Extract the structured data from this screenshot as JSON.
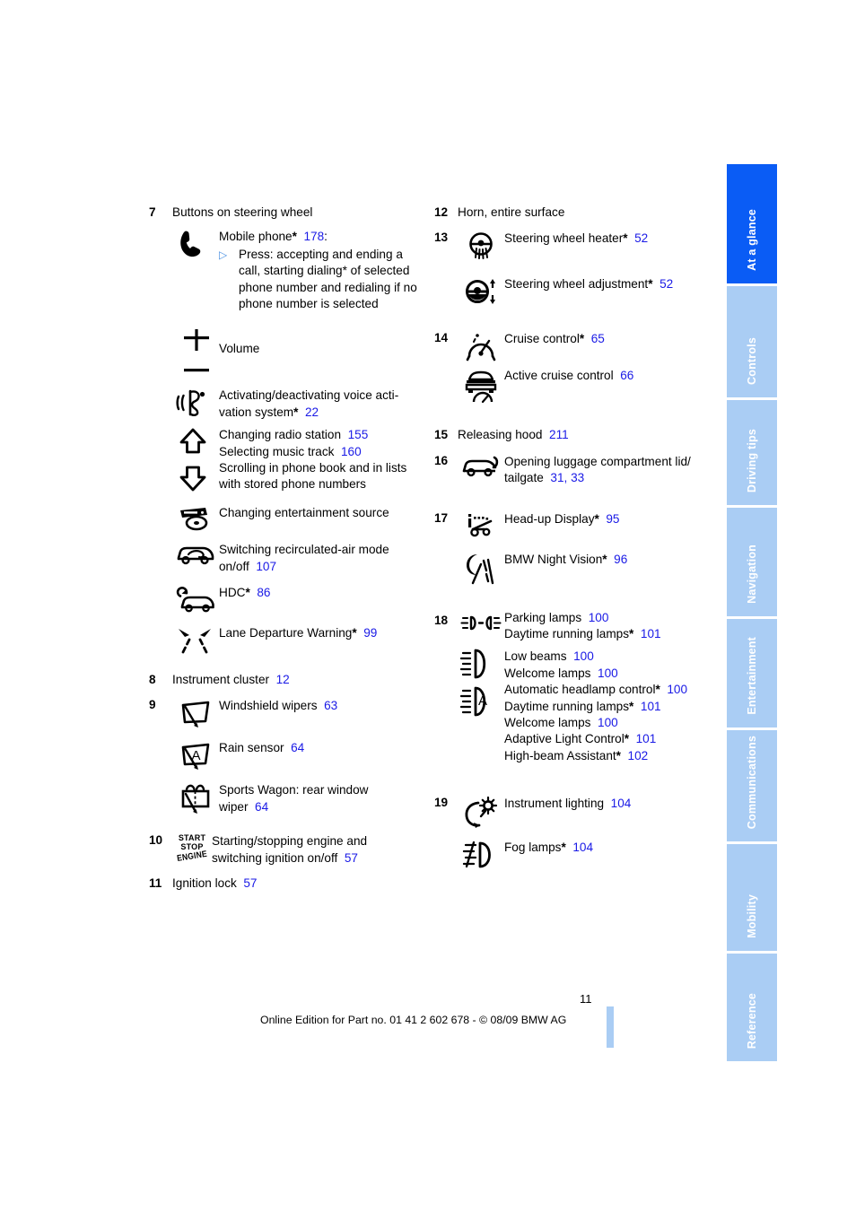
{
  "page": {
    "number": "11",
    "footer": "Online Edition for Part no. 01 41 2 602 678 - © 08/09 BMW AG"
  },
  "colors": {
    "page_ref": "#1a1ae6",
    "tab_active": "#0a5cf5",
    "tab_inactive": "#aacdf4",
    "bullet": "#4a90e2"
  },
  "tabs": [
    {
      "label": "At a glance",
      "active": true
    },
    {
      "label": "Controls",
      "active": false
    },
    {
      "label": "Driving tips",
      "active": false
    },
    {
      "label": "Navigation",
      "active": false
    },
    {
      "label": "Entertainment",
      "active": false
    },
    {
      "label": "Communications",
      "active": false
    },
    {
      "label": "Mobility",
      "active": false
    },
    {
      "label": "Reference",
      "active": false
    }
  ],
  "left_column": {
    "item7": {
      "num": "7",
      "title": "Buttons on steering wheel",
      "phone_label": "Mobile phone",
      "phone_star": "*",
      "phone_page": "178",
      "phone_colon": ":",
      "phone_sub": "Press: accepting and ending a call, starting dialing* of selected phone number and redialing if no phone number is selected",
      "volume_label": "Volume",
      "voice_label": "Activating/deactivating voice acti-vation system",
      "voice_star": "*",
      "voice_page": "22",
      "radio_label": "Changing radio station",
      "radio_page": "155",
      "music_label": "Selecting music track",
      "music_page": "160",
      "scroll_label": "Scrolling in phone book and in lists with stored phone numbers",
      "entertainment_label": "Changing entertainment source",
      "recirc_label": "Switching recirculated-air mode on/off",
      "recirc_page": "107",
      "hdc_label": "HDC",
      "hdc_star": "*",
      "hdc_page": "86",
      "ldw_label": "Lane Departure Warning",
      "ldw_star": "*",
      "ldw_page": "99"
    },
    "item8": {
      "num": "8",
      "label": "Instrument cluster",
      "page": "12"
    },
    "item9": {
      "num": "9",
      "wipers_label": "Windshield wipers",
      "wipers_page": "63",
      "rain_label": "Rain sensor",
      "rain_page": "64",
      "wagon_label": "Sports Wagon: rear window wiper",
      "wagon_page": "64"
    },
    "item10": {
      "num": "10",
      "icon_line1": "START",
      "icon_line2": "STOP",
      "icon_line3": "ENGINE",
      "label": "Starting/stopping engine and switching ignition on/off",
      "page": "57"
    },
    "item11": {
      "num": "11",
      "label": "Ignition lock",
      "page": "57"
    }
  },
  "right_column": {
    "item12": {
      "num": "12",
      "label": "Horn, entire surface"
    },
    "item13": {
      "num": "13",
      "heater_label": "Steering wheel heater",
      "heater_star": "*",
      "heater_page": "52",
      "adjust_label": "Steering wheel adjustment",
      "adjust_star": "*",
      "adjust_page": "52"
    },
    "item14": {
      "num": "14",
      "cruise_label": "Cruise control",
      "cruise_star": "*",
      "cruise_page": "65",
      "active_label": "Active cruise control",
      "active_page": "66"
    },
    "item15": {
      "num": "15",
      "label": "Releasing hood",
      "page": "211"
    },
    "item16": {
      "num": "16",
      "label": "Opening luggage compartment lid/ tailgate",
      "page_a": "31",
      "page_sep": ",",
      "page_b": "33"
    },
    "item17": {
      "num": "17",
      "hud_label": "Head-up Display",
      "hud_star": "*",
      "hud_page": "95",
      "night_label": "BMW Night Vision",
      "night_star": "*",
      "night_page": "96"
    },
    "item18": {
      "num": "18",
      "parking_label": "Parking lamps",
      "parking_page": "100",
      "drl1_label": "Daytime running lamps",
      "drl1_star": "*",
      "drl1_page": "101",
      "low_label": "Low beams",
      "low_page": "100",
      "welcome1_label": "Welcome lamps",
      "welcome1_page": "100",
      "auto_label": "Automatic headlamp control",
      "auto_star": "*",
      "auto_page": "100",
      "drl2_label": "Daytime running lamps",
      "drl2_star": "*",
      "drl2_page": "101",
      "welcome2_label": "Welcome lamps",
      "welcome2_page": "100",
      "alc_label": "Adaptive Light Control",
      "alc_star": "*",
      "alc_page": "101",
      "hba_label": "High-beam Assistant",
      "hba_star": "*",
      "hba_page": "102"
    },
    "item19": {
      "num": "19",
      "instr_label": "Instrument lighting",
      "instr_page": "104",
      "fog_label": "Fog lamps",
      "fog_star": "*",
      "fog_page": "104"
    }
  }
}
